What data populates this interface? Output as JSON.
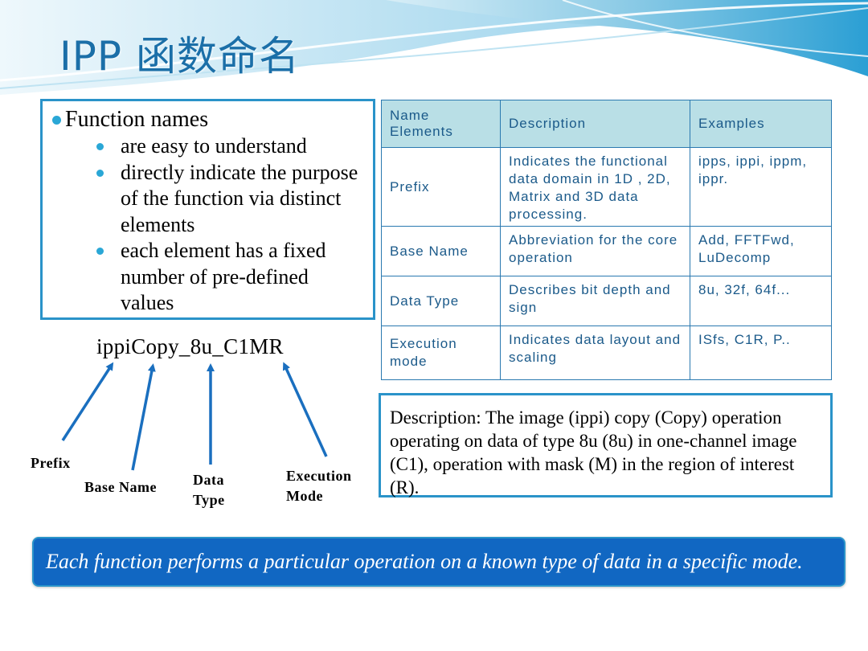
{
  "slide": {
    "title": "IPP 函数命名",
    "bullets": {
      "main": "Function names",
      "items": [
        "are easy to understand",
        "directly indicate the purpose of the function via distinct elements",
        "each element has a fixed number of pre-defined values"
      ]
    },
    "table": {
      "headers": [
        "Name Elements",
        "Description",
        "Examples"
      ],
      "rows": [
        {
          "name": "Prefix",
          "description": "Indicates the functional data domain in 1D , 2D, Matrix and 3D data processing.",
          "examples": "ipps, ippi, ippm, ippr."
        },
        {
          "name": "Base Name",
          "description": "Abbreviation for the core operation",
          "examples": "Add, FFTFwd, LuDecomp"
        },
        {
          "name": "Data Type",
          "description": "Describes bit depth and sign",
          "examples": "8u, 32f, 64f..."
        },
        {
          "name": "Execution mode",
          "description": "Indicates data layout and scaling",
          "examples": "ISfs, C1R, P.."
        }
      ]
    },
    "function_example": "ippiCopy_8u_C1MR",
    "labels": {
      "prefix": "Prefix",
      "base_name": "Base Name",
      "data_type_line1": "Data",
      "data_type_line2": "Type",
      "execution_line1": "Execution",
      "execution_line2": "Mode"
    },
    "description": "Description: The image (ippi) copy (Copy) operation operating on data of type 8u (8u) in one-channel image (C1), operation with mask (M) in the region of interest (R).",
    "banner": "Each function performs a particular operation on a known type of  data in a specific mode."
  },
  "colors": {
    "title": "#1b6fa8",
    "accent_border": "#2a93c9",
    "table_header_bg": "#b9dfe6",
    "banner_bg": "#1167c2",
    "arrow": "#1a6fbf"
  }
}
